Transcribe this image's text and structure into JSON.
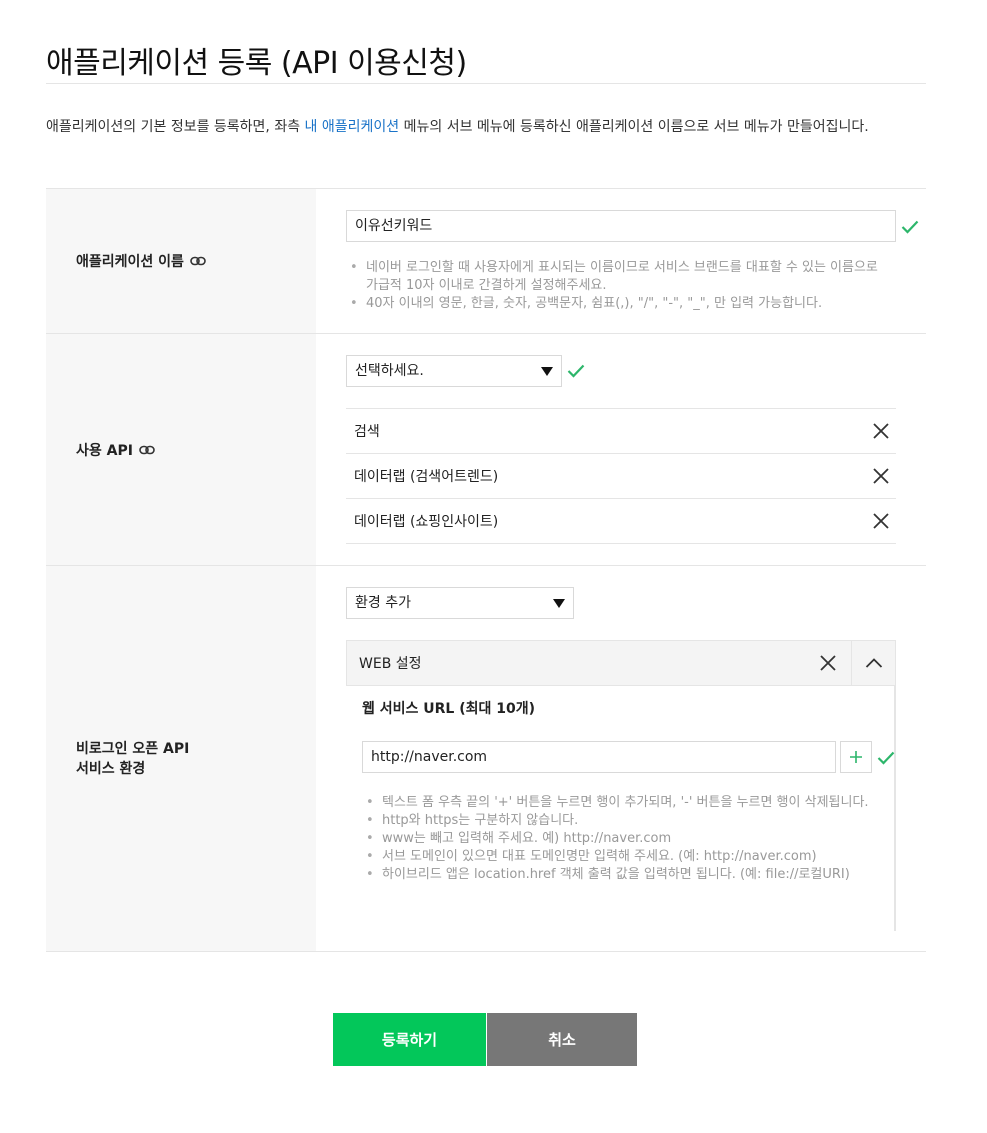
{
  "header": {
    "title": "애플리케이션 등록 (API 이용신청)"
  },
  "intro": {
    "text_before": "애플리케이션의 기본 정보를 등록하면, 좌측 ",
    "link": "내 애플리케이션",
    "text_after": " 메뉴의 서브 메뉴에 등록하신 애플리케이션 이름으로 서브 메뉴가 만들어집니다."
  },
  "app_name": {
    "label": "애플리케이션 이름",
    "value": "이유선키워드",
    "hints": [
      "네이버 로그인할 때 사용자에게 표시되는 이름이므로 서비스 브랜드를 대표할 수 있는 이름으로 가급적 10자 이내로 간결하게 설정해주세요.",
      "40자 이내의 영문, 한글, 숫자, 공백문자, 쉼표(,), \"/\", \"-\", \"_\", 만 입력 가능합니다."
    ]
  },
  "api": {
    "label": "사용 API",
    "select_value": "선택하세요.",
    "items": [
      "검색",
      "데이터랩 (검색어트렌드)",
      "데이터랩 (쇼핑인사이트)"
    ]
  },
  "env": {
    "label_line1": "비로그인 오픈 API",
    "label_line2": "서비스 환경",
    "select_value": "환경 추가",
    "panel_title": "WEB 설정",
    "subtitle": "웹 서비스 URL (최대 10개)",
    "url_value": "http://naver.com",
    "hints": [
      "텍스트 폼 우측 끝의 '+' 버튼을 누르면 행이 추가되며, '-' 버튼을 누르면 행이 삭제됩니다.",
      "http와 https는 구분하지 않습니다.",
      "www는 빼고 입력해 주세요. 예) http://naver.com",
      "서브 도메인이 있으면 대표 도메인명만 입력해 주세요. (예: http://naver.com)",
      "하이브리드 앱은 location.href 객체 출력 값을 입력하면 됩니다. (예: file://로컬URI)"
    ]
  },
  "buttons": {
    "register": "등록하기",
    "cancel": "취소"
  },
  "colors": {
    "accent_green": "#03c75a",
    "check_green": "#2db66b",
    "link_blue": "#1a73c8",
    "cancel_gray": "#777777"
  }
}
